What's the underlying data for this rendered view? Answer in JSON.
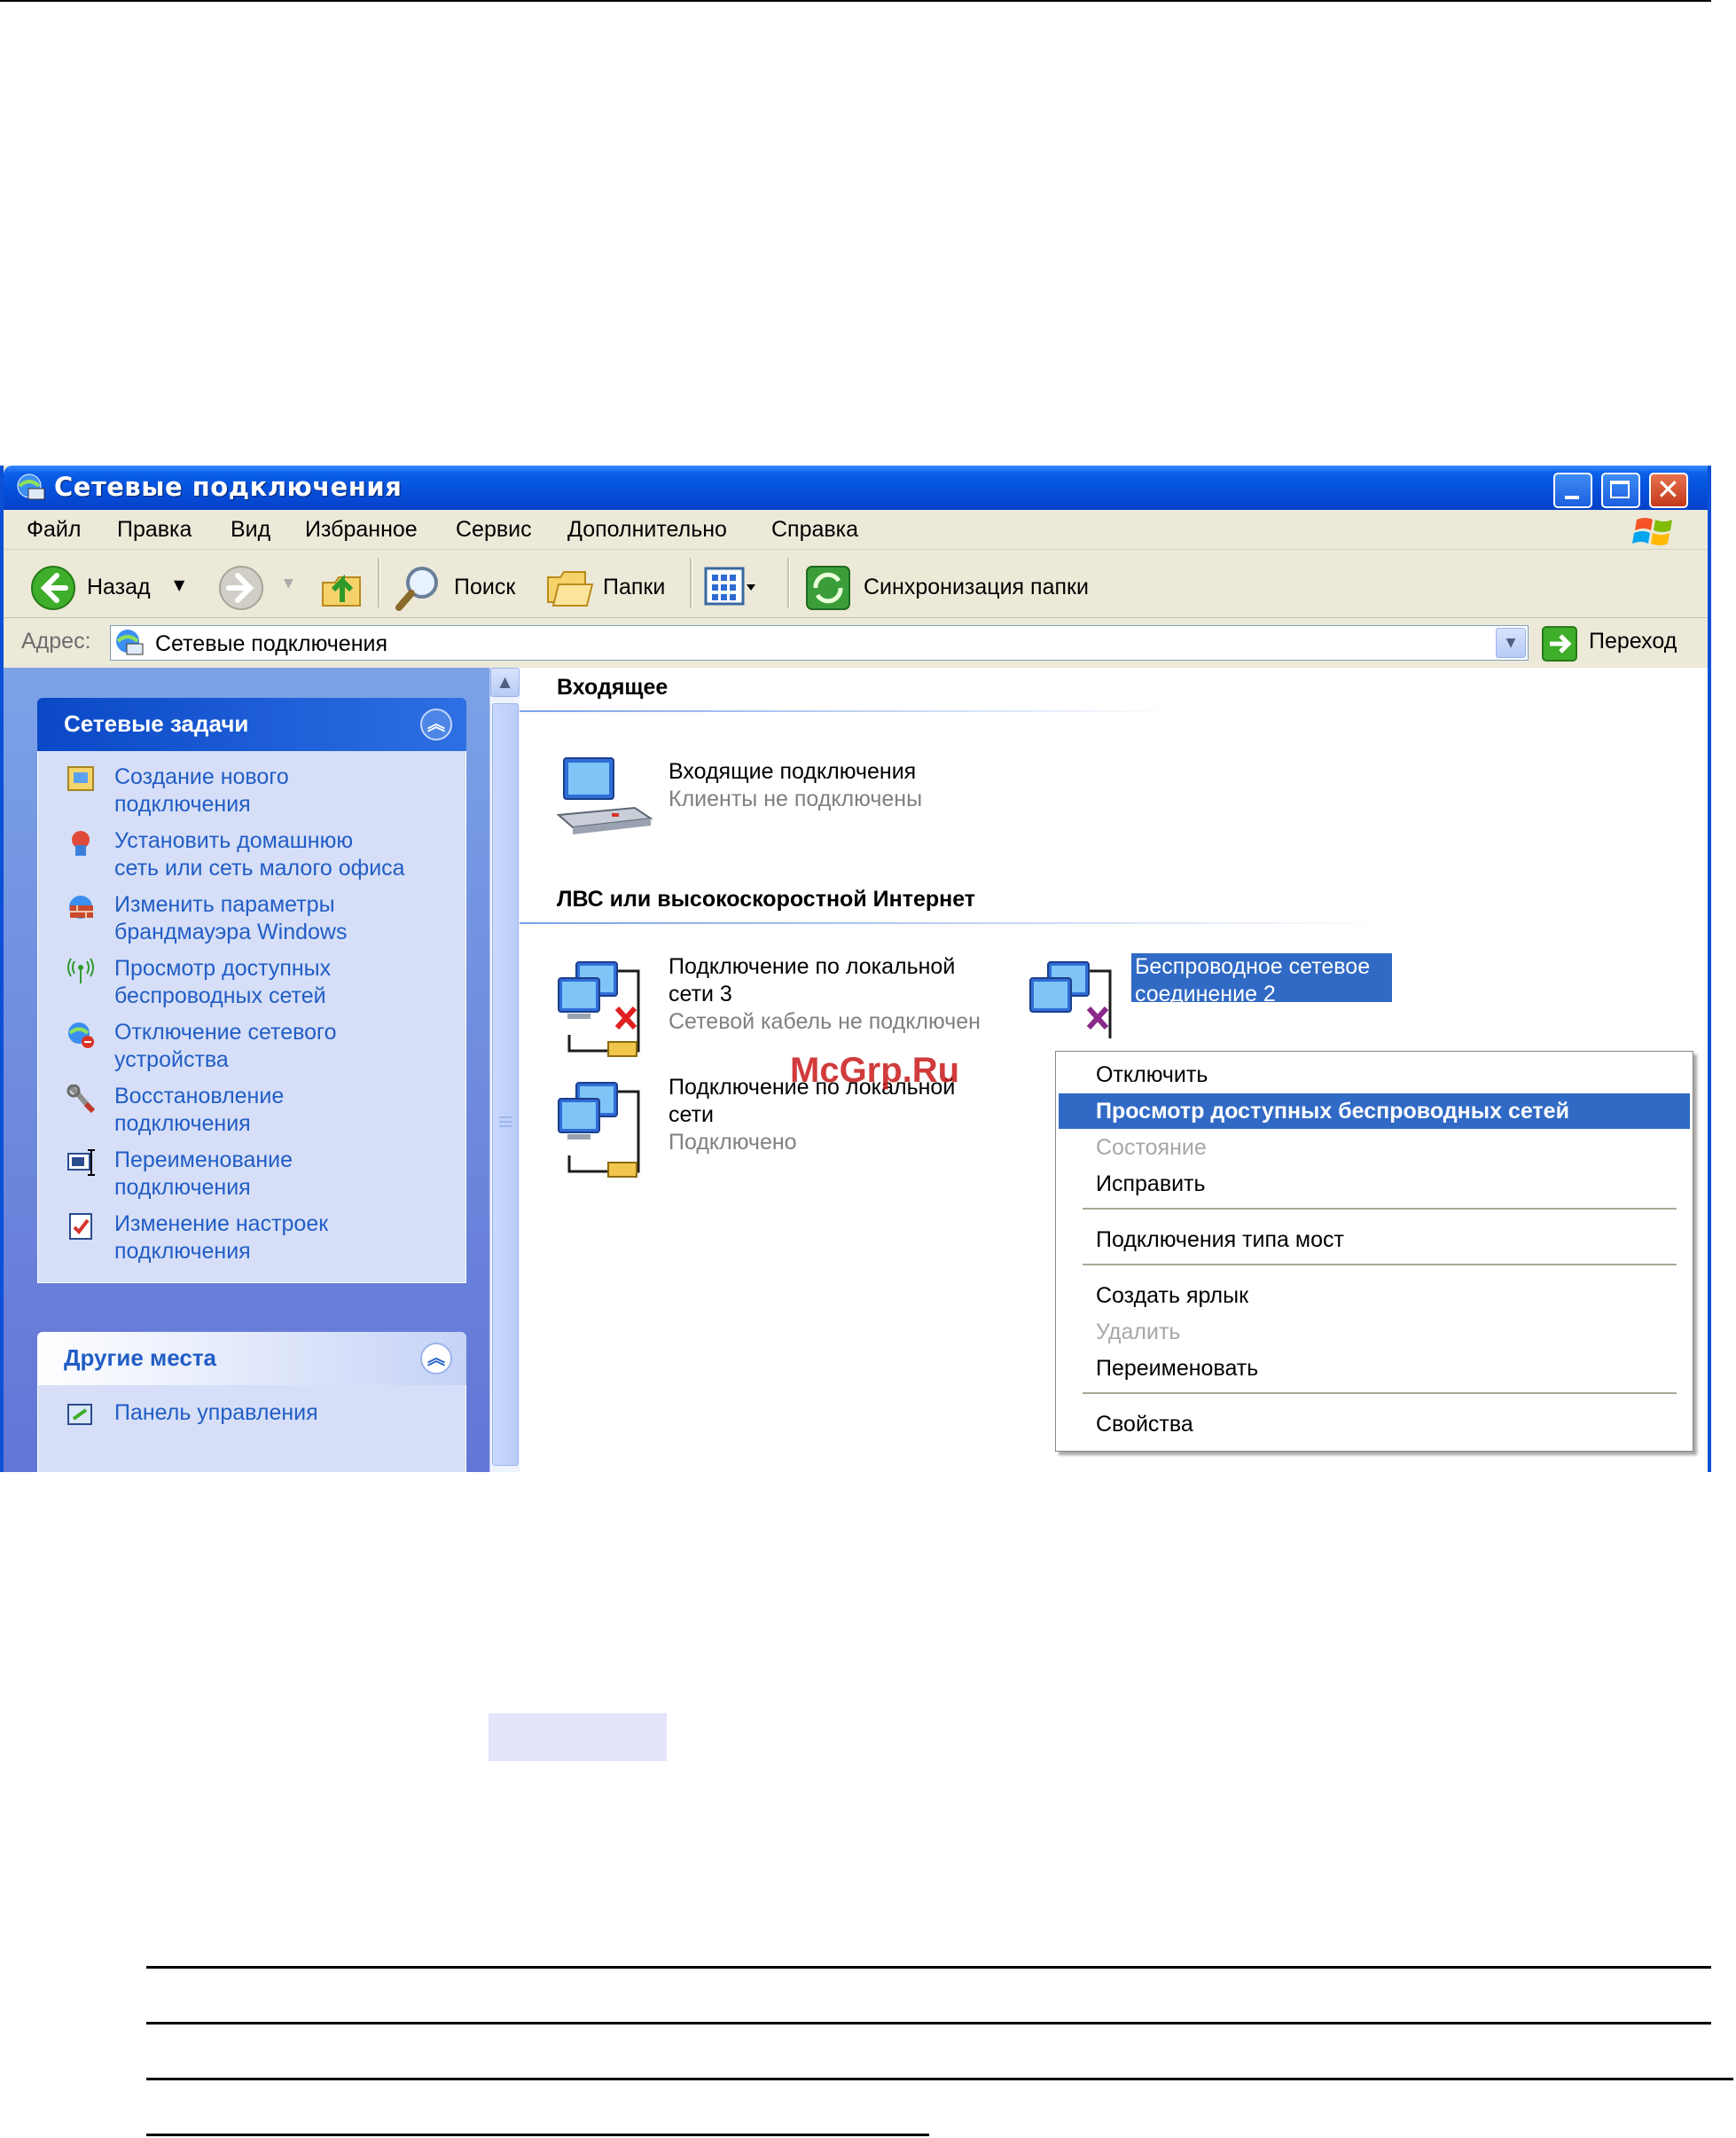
{
  "window": {
    "title": "Сетевые подключения"
  },
  "menubar": [
    "Файл",
    "Правка",
    "Вид",
    "Избранное",
    "Сервис",
    "Дополнительно",
    "Справка"
  ],
  "toolbar": {
    "back": "Назад",
    "search": "Поиск",
    "folders": "Папки",
    "sync": "Синхронизация папки"
  },
  "address": {
    "label": "Адрес:",
    "value": "Сетевые подключения",
    "go": "Переход"
  },
  "tasks_panel": {
    "title": "Сетевые задачи",
    "items": [
      {
        "label": "Создание нового\nподключения",
        "icon": "new-connection-icon"
      },
      {
        "label": "Установить домашнюю\nсеть или сеть малого офиса",
        "icon": "home-network-icon"
      },
      {
        "label": "Изменить параметры\nбрандмауэра Windows",
        "icon": "firewall-icon"
      },
      {
        "label": "Просмотр доступных\nбеспроводных сетей",
        "icon": "wireless-icon"
      },
      {
        "label": "Отключение сетевого\nустройства",
        "icon": "disable-device-icon"
      },
      {
        "label": "Восстановление\nподключения",
        "icon": "repair-icon"
      },
      {
        "label": "Переименование\nподключения",
        "icon": "rename-icon"
      },
      {
        "label": "Изменение настроек\nподключения",
        "icon": "settings-icon"
      }
    ]
  },
  "places_panel": {
    "title": "Другие места",
    "items": [
      {
        "label": "Панель управления",
        "icon": "control-panel-icon"
      }
    ]
  },
  "groups": {
    "incoming": {
      "title": "Входящее",
      "item": {
        "name": "Входящие подключения",
        "status": "Клиенты не подключены"
      }
    },
    "lan": {
      "title": "ЛВС или высокоскоростной Интернет",
      "items": [
        {
          "name": "Подключение по локальной\nсети 3",
          "status": "Сетевой кабель не подключен"
        },
        {
          "name": "Подключение по локальной\nсети",
          "status": "Подключено"
        },
        {
          "name": "Беспроводное сетевое\nсоединение 2",
          "status": ""
        }
      ]
    }
  },
  "context_menu": {
    "items": [
      {
        "label": "Отключить",
        "state": "normal"
      },
      {
        "label": "Просмотр доступных беспроводных сетей",
        "state": "highlighted"
      },
      {
        "label": "Состояние",
        "state": "disabled"
      },
      {
        "label": "Исправить",
        "state": "normal"
      },
      {
        "label": "Подключения типа мост",
        "state": "normal"
      },
      {
        "label": "Создать ярлык",
        "state": "normal"
      },
      {
        "label": "Удалить",
        "state": "disabled"
      },
      {
        "label": "Переименовать",
        "state": "normal"
      },
      {
        "label": "Свойства",
        "state": "normal"
      }
    ]
  },
  "watermark": "McGrp.Ru",
  "colors": {
    "title_bar": "#0550dc",
    "task_link": "#215dc6",
    "menu_highlight": "#316ac5"
  }
}
